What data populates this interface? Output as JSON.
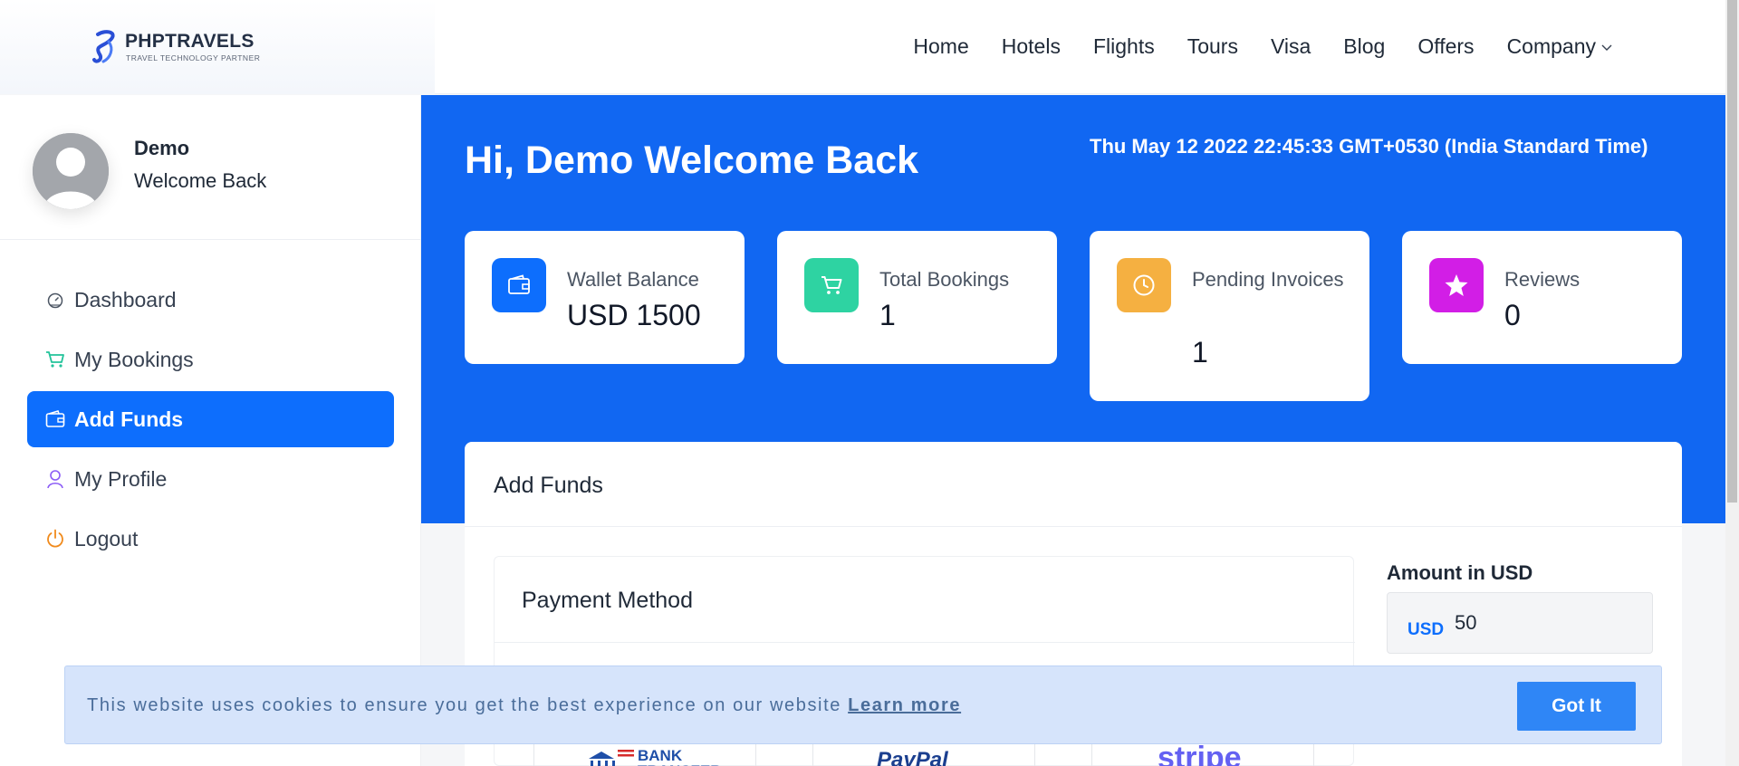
{
  "brand": {
    "name": "PHPTRAVELS",
    "tagline": "TRAVEL TECHNOLOGY PARTNER"
  },
  "nav": {
    "items": [
      {
        "label": "Home"
      },
      {
        "label": "Hotels"
      },
      {
        "label": "Flights"
      },
      {
        "label": "Tours"
      },
      {
        "label": "Visa"
      },
      {
        "label": "Blog"
      },
      {
        "label": "Offers"
      },
      {
        "label": "Company",
        "has_dropdown": true
      }
    ]
  },
  "sidebar": {
    "user": {
      "name": "Demo",
      "subtitle": "Welcome Back"
    },
    "items": [
      {
        "label": "Dashboard",
        "icon": "dashboard-gauge-icon"
      },
      {
        "label": "My Bookings",
        "icon": "cart-icon"
      },
      {
        "label": "Add Funds",
        "icon": "wallet-icon",
        "active": true
      },
      {
        "label": "My Profile",
        "icon": "user-icon"
      },
      {
        "label": "Logout",
        "icon": "power-icon"
      }
    ]
  },
  "hero": {
    "greeting": "Hi, Demo Welcome Back",
    "datetime": "Thu May 12 2022 22:45:33 GMT+0530 (India Standard Time)",
    "stats": [
      {
        "label": "Wallet Balance",
        "value": "USD 1500",
        "icon": "wallet-icon",
        "color": "#0d6efd"
      },
      {
        "label": "Total Bookings",
        "value": "1",
        "icon": "cart-icon",
        "color": "#2ed3a2"
      },
      {
        "label": "Pending Invoices",
        "value": "1",
        "icon": "clock-icon",
        "color": "#f5b041"
      },
      {
        "label": "Reviews",
        "value": "0",
        "icon": "star-icon",
        "color": "#d21ee6"
      }
    ]
  },
  "funds": {
    "title": "Add Funds",
    "payment_method_title": "Payment Method",
    "payment_options": [
      "BANK TRANSFER",
      "PayPal",
      "stripe"
    ],
    "amount_label": "Amount in USD",
    "currency": "USD",
    "amount_value": "50"
  },
  "cookie": {
    "text": "This website uses cookies to ensure you get the best experience on our website",
    "link": "Learn more",
    "button": "Got It"
  },
  "colors": {
    "primary": "#0d6efd",
    "hero_bg": "#1167f2",
    "cookie_bg": "#d6e4fb"
  }
}
